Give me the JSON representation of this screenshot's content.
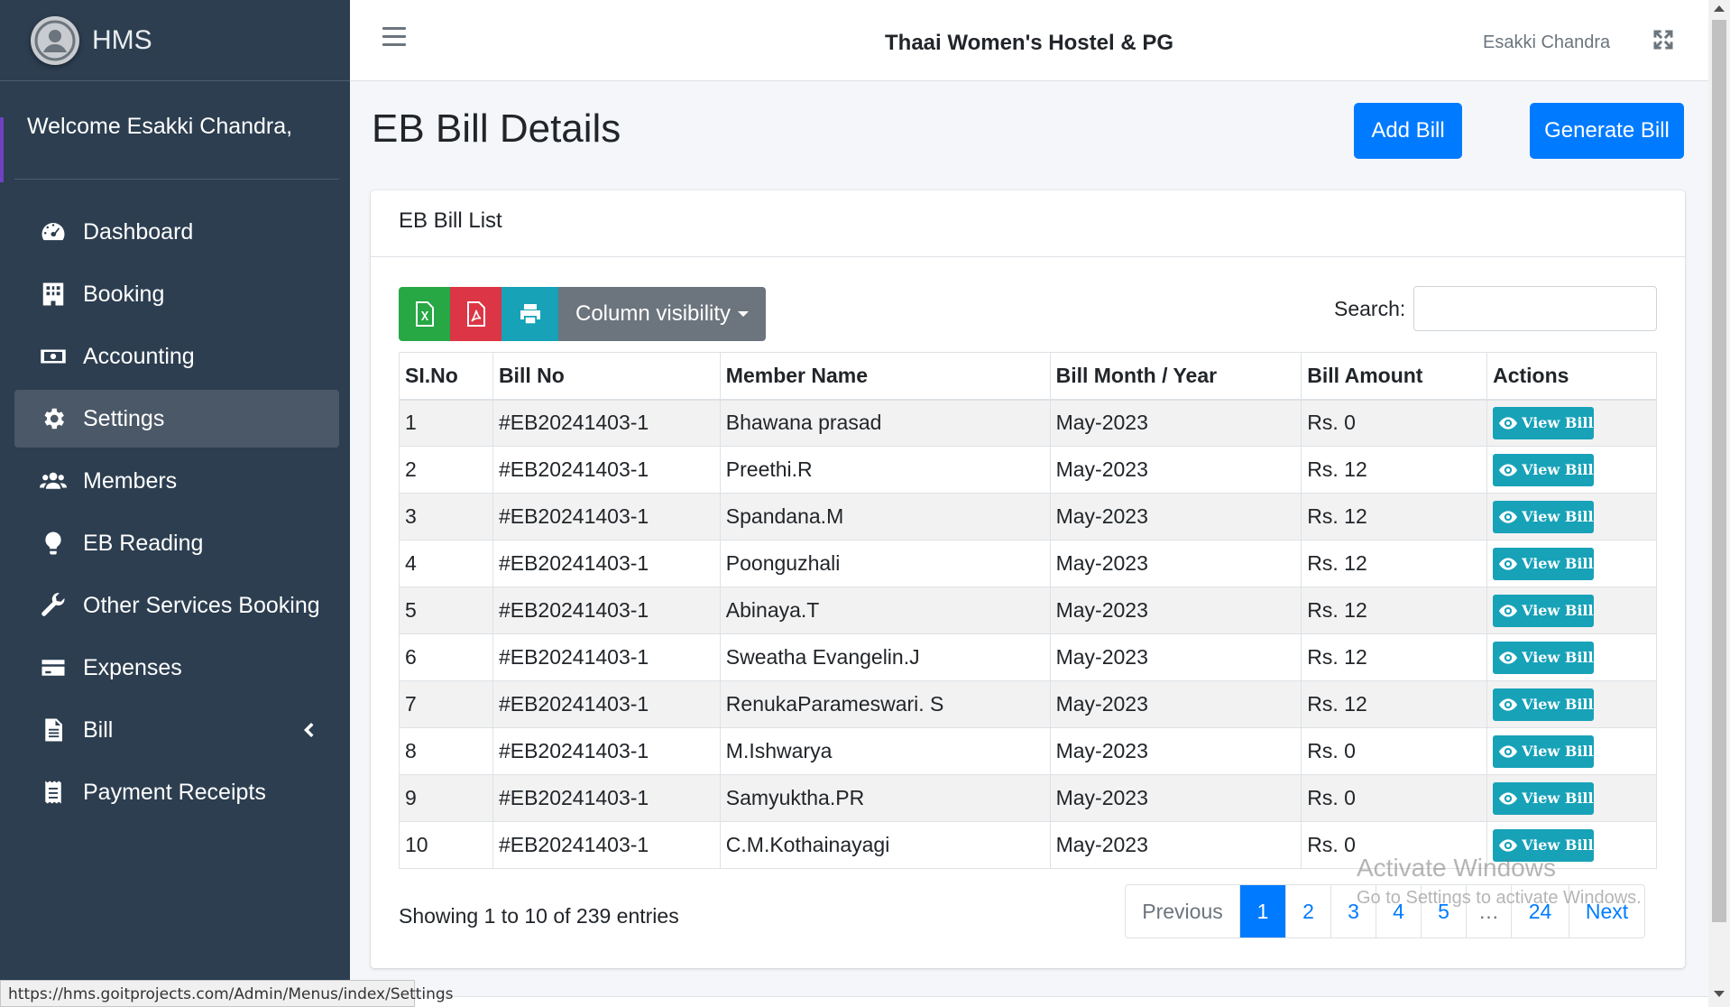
{
  "app": {
    "brand": "HMS",
    "title": "Thaai Women's Hostel & PG",
    "user": "Esakki Chandra"
  },
  "sidebar": {
    "welcome": "Welcome Esakki Chandra,",
    "items": [
      {
        "label": "Dashboard",
        "icon": "dashboard-icon"
      },
      {
        "label": "Booking",
        "icon": "building-icon"
      },
      {
        "label": "Accounting",
        "icon": "money-bill-icon"
      },
      {
        "label": "Settings",
        "icon": "gear-icon",
        "active": true
      },
      {
        "label": "Members",
        "icon": "users-icon"
      },
      {
        "label": "EB Reading",
        "icon": "lightbulb-icon"
      },
      {
        "label": "Other Services Booking",
        "icon": "wrench-icon"
      },
      {
        "label": "Expenses",
        "icon": "credit-card-icon"
      },
      {
        "label": "Bill",
        "icon": "file-icon"
      },
      {
        "label": "Payment Receipts",
        "icon": "receipt-icon"
      }
    ]
  },
  "page": {
    "title": "EB Bill Details",
    "add_bill": "Add Bill",
    "generate_bill": "Generate Bill"
  },
  "card": {
    "title": "EB Bill List",
    "column_visibility": "Column visibility",
    "search_label": "Search:",
    "search_value": ""
  },
  "table": {
    "headers": [
      "SI.No",
      "Bill No",
      "Member Name",
      "Bill Month / Year",
      "Bill Amount",
      "Actions"
    ],
    "action_label": "View Bill",
    "rows": [
      [
        "1",
        "#EB20241403-1",
        "Bhawana prasad",
        "May-2023",
        "Rs. 0"
      ],
      [
        "2",
        "#EB20241403-1",
        "Preethi.R",
        "May-2023",
        "Rs. 12"
      ],
      [
        "3",
        "#EB20241403-1",
        "Spandana.M",
        "May-2023",
        "Rs. 12"
      ],
      [
        "4",
        "#EB20241403-1",
        "Poonguzhali",
        "May-2023",
        "Rs. 12"
      ],
      [
        "5",
        "#EB20241403-1",
        "Abinaya.T",
        "May-2023",
        "Rs. 12"
      ],
      [
        "6",
        "#EB20241403-1",
        "Sweatha Evangelin.J",
        "May-2023",
        "Rs. 12"
      ],
      [
        "7",
        "#EB20241403-1",
        "RenukaParameswari. S",
        "May-2023",
        "Rs. 12"
      ],
      [
        "8",
        "#EB20241403-1",
        "M.Ishwarya",
        "May-2023",
        "Rs. 0"
      ],
      [
        "9",
        "#EB20241403-1",
        "Samyuktha.PR",
        "May-2023",
        "Rs. 0"
      ],
      [
        "10",
        "#EB20241403-1",
        "C.M.Kothainayagi",
        "May-2023",
        "Rs. 0"
      ]
    ]
  },
  "footer": {
    "info": "Showing 1 to 10 of 239 entries",
    "pagination": {
      "previous": "Previous",
      "pages": [
        "1",
        "2",
        "3",
        "4",
        "5"
      ],
      "ellipsis": "…",
      "last": "24",
      "next": "Next"
    }
  },
  "watermark": {
    "line1": "Activate Windows",
    "line2": "Go to Settings to activate Windows."
  },
  "statusbar": "https://hms.goitprojects.com/Admin/Menus/index/Settings",
  "colors": {
    "sidebar": "#2c3e50",
    "primary": "#007bff",
    "info": "#17a2b8",
    "excel": "#28a745",
    "pdf": "#dc3545"
  }
}
